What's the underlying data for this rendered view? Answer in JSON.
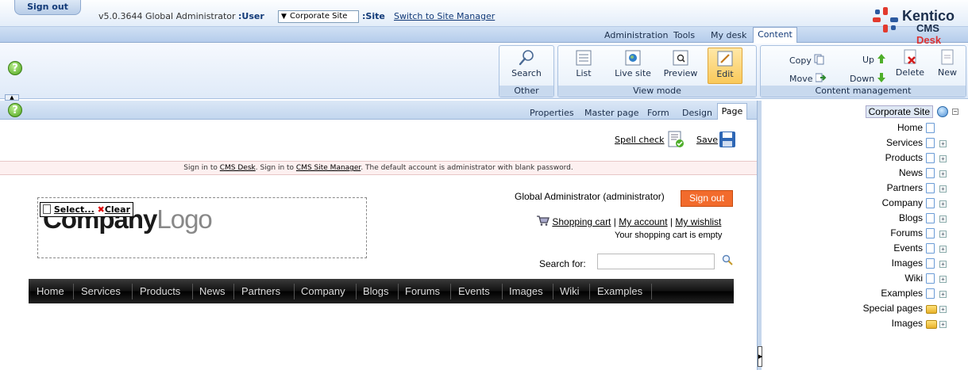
{
  "header": {
    "signout": "Sign out",
    "version": "v5.0.3644  Global Administrator",
    "user_label": ":User",
    "site_select": "Corporate Site",
    "site_label": ":Site",
    "switch_link": "Switch to Site Manager",
    "nav": [
      "Administration",
      "Tools",
      "My desk"
    ],
    "active_tab": "Content",
    "logo_name": "Kentico",
    "logo_sub_a": "CMS",
    "logo_sub_b": "Desk"
  },
  "toolbar": {
    "other": {
      "title": "Other",
      "search": "Search"
    },
    "view_mode": {
      "title": "View mode",
      "list": "List",
      "live_site": "Live site",
      "preview": "Preview",
      "edit": "Edit"
    },
    "content_management": {
      "title": "Content management",
      "copy": "Copy",
      "move": "Move",
      "up": "Up",
      "down": "Down",
      "delete": "Delete",
      "new": "New"
    }
  },
  "subtabs": [
    "Properties",
    "Master page",
    "Form",
    "Design"
  ],
  "active_subtab": "Page",
  "actions": {
    "spell_check": "Spell check",
    "save": "Save"
  },
  "signin_bar": {
    "a": "Sign in to ",
    "cms_desk": "CMS Desk",
    "b": ". Sign in to ",
    "site_manager": "CMS Site Manager",
    "c": ". The default account is administrator with blank password."
  },
  "site": {
    "logo_a": "Company",
    "logo_b": "Logo",
    "select": "Select...",
    "clear": "Clear",
    "user_text": "Global Administrator (administrator)",
    "signout": "Sign out",
    "cart": "Shopping cart",
    "sep1": " | ",
    "account": "My account",
    "sep2": " | ",
    "wishlist": "My wishlist",
    "cart_empty": "Your shopping cart is empty",
    "search_label": "Search for:",
    "search_value": "",
    "menu": [
      "Home",
      "Services",
      "Products",
      "News",
      "Partners",
      "Company",
      "Blogs",
      "Forums",
      "Events",
      "Images",
      "Wiki",
      "Examples"
    ]
  },
  "tree": {
    "root": "Corporate Site",
    "nodes": [
      {
        "label": "Home",
        "icon": "document-icon",
        "expandable": false
      },
      {
        "label": "Services",
        "icon": "document-icon",
        "expandable": true
      },
      {
        "label": "Products",
        "icon": "document-icon",
        "expandable": true
      },
      {
        "label": "News",
        "icon": "document-icon",
        "expandable": true
      },
      {
        "label": "Partners",
        "icon": "document-icon",
        "expandable": true
      },
      {
        "label": "Company",
        "icon": "document-icon",
        "expandable": true
      },
      {
        "label": "Blogs",
        "icon": "document-icon",
        "expandable": true
      },
      {
        "label": "Forums",
        "icon": "document-icon",
        "expandable": true
      },
      {
        "label": "Events",
        "icon": "document-icon",
        "expandable": true
      },
      {
        "label": "Images",
        "icon": "document-icon",
        "expandable": true
      },
      {
        "label": "Wiki",
        "icon": "document-icon",
        "expandable": true
      },
      {
        "label": "Examples",
        "icon": "document-icon",
        "expandable": true
      },
      {
        "label": "Special pages",
        "icon": "folder-icon",
        "expandable": true
      },
      {
        "label": "Images",
        "icon": "folder-icon",
        "expandable": true
      }
    ]
  },
  "colors": {
    "accent": "#123a78",
    "signout_orange": "#f26b2c",
    "edit_highlight": "#f9c95a"
  }
}
